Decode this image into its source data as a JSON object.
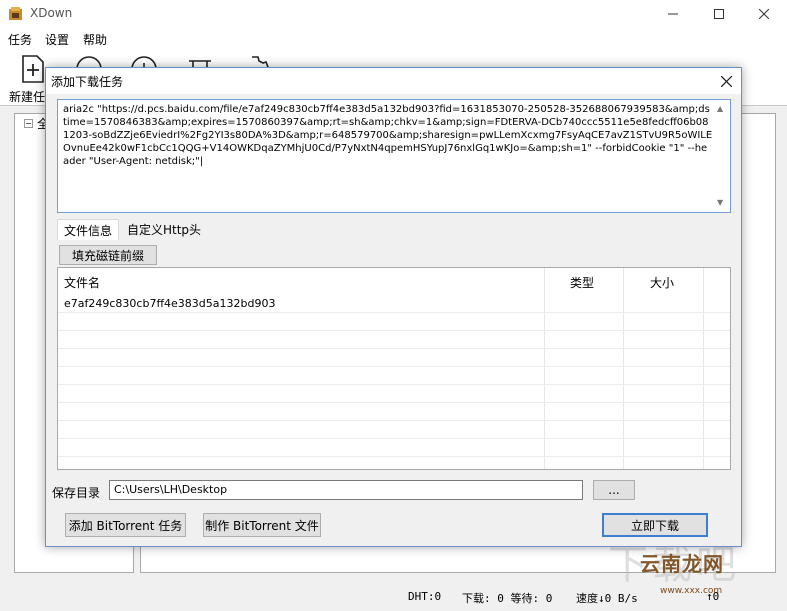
{
  "app": {
    "title": "XDown",
    "colors": {
      "accent": "#3c7fd1",
      "titlebar": "#ffffff",
      "surface": "#f0f0f0"
    }
  },
  "window_controls": {
    "minimize": "minimize-icon",
    "maximize": "maximize-icon",
    "close": "close-icon"
  },
  "menu": {
    "task": "任务",
    "settings": "设置",
    "help": "帮助"
  },
  "toolbar": {
    "new_task_label": "新建任",
    "icons": [
      "new-task-icon",
      "add-circle-icon",
      "info-circle-icon",
      "delete-icon",
      "settings-icon"
    ]
  },
  "sidebar": {
    "root_label": "全",
    "expander": "−"
  },
  "statusbar": {
    "dht": "DHT:0",
    "download": "下载: 0 等待: 0",
    "speed": "速度↓0 B/s",
    "tail": "↑0"
  },
  "watermark": {
    "text": "云南龙网",
    "url": "www.xxx.com",
    "ghost": "下载吧"
  },
  "dialog": {
    "title": "添加下载任务",
    "command": "aria2c \"https://d.pcs.baidu.com/file/e7af249c830cb7ff4e383d5a132bd903?fid=1631853070-250528-352688067939583&amp;dstime=1570846383&amp;expires=1570860397&amp;rt=sh&amp;chkv=1&amp;sign=FDtERVA-DCb740ccc5511e5e8fedcff06b081203-soBdZZje6EviedrI%2Fg2YI3s80DA%3D&amp;r=648579700&amp;sharesign=pwLLemXcxmg7FsyAqCE7avZ1STvU9R5oWILEOvnuEe42k0wF1cbCc1QQG+V14OWKDqaZYMhjU0Cd/P7yNxtN4qpemHSYupJ76nxlGq1wKJo=&amp;sh=1\" --forbidCookie \"1\" --header \"User-Agent: netdisk;\"|",
    "tabs": [
      {
        "label": "文件信息"
      },
      {
        "label": "自定义Http头"
      }
    ],
    "fill_magnet_prefix_label": "填充磁链前缀",
    "file_table": {
      "columns": [
        "文件名",
        "类型",
        "大小"
      ],
      "rows": [
        {
          "name": "e7af249c830cb7ff4e383d5a132bd903",
          "type": "",
          "size": ""
        }
      ]
    },
    "save_dir": {
      "label": "保存目录",
      "value": "C:\\Users\\LH\\Desktop",
      "browse_label": "..."
    },
    "buttons": {
      "add_bittorrent": "添加 BitTorrent 任务",
      "make_bittorrent": "制作 BitTorrent 文件",
      "download_now": "立即下载"
    }
  }
}
